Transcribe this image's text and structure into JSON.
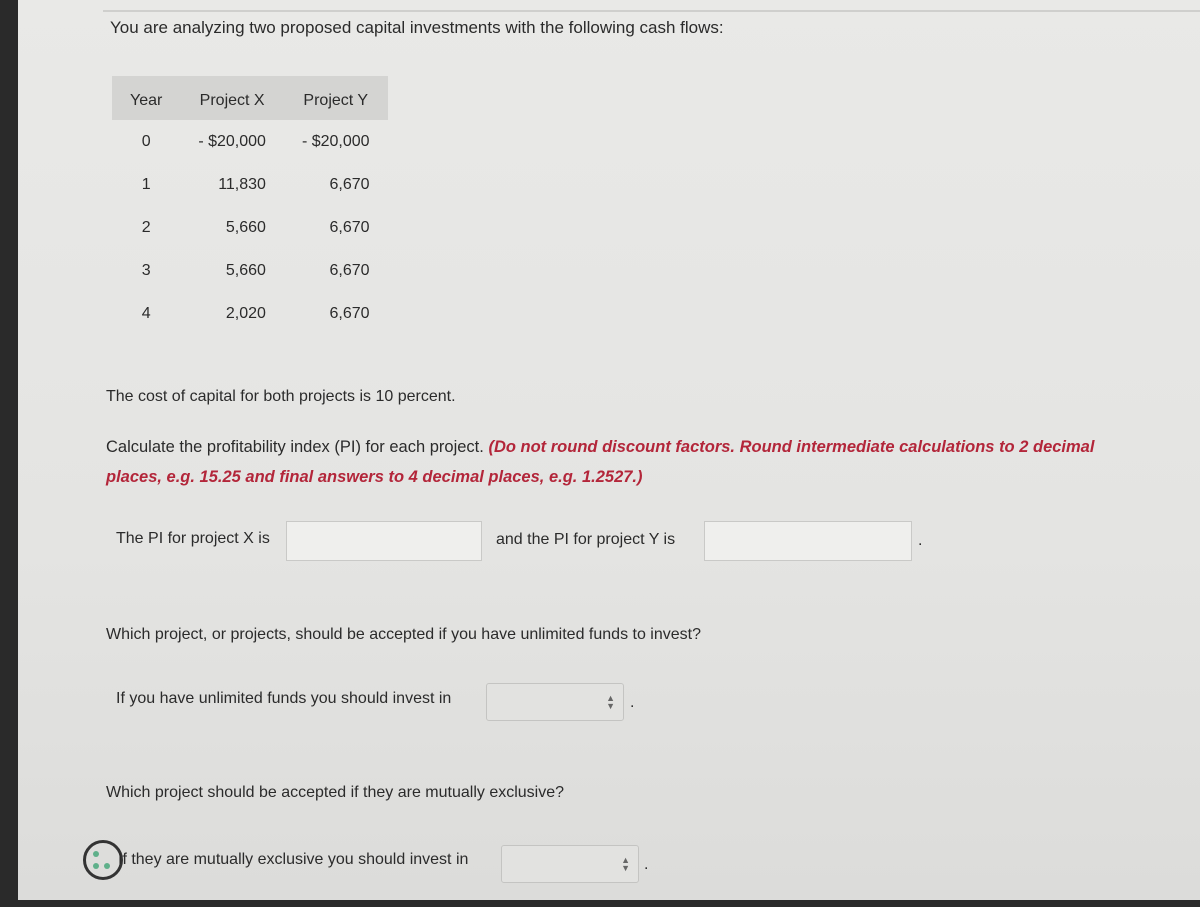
{
  "intro": "You are analyzing two proposed capital investments with the following cash flows:",
  "table": {
    "headers": [
      "Year",
      "Project X",
      "Project Y"
    ],
    "rows": [
      [
        "0",
        "- $20,000",
        "- $20,000"
      ],
      [
        "1",
        "11,830",
        "6,670"
      ],
      [
        "2",
        "5,660",
        "6,670"
      ],
      [
        "3",
        "5,660",
        "6,670"
      ],
      [
        "4",
        "2,020",
        "6,670"
      ]
    ]
  },
  "cost_of_capital": "The cost of capital for both projects is 10 percent.",
  "instruction": "Calculate the profitability index (PI) for each project.",
  "instruction_note": "(Do not round discount factors. Round intermediate calculations to 2 decimal places, e.g. 15.25 and final answers to 4 decimal places, e.g. 1.2527.)",
  "pi_x_label": "The PI for project X is",
  "pi_x_value": "",
  "pi_y_label": "and the PI for project Y is",
  "pi_y_value": "",
  "period": ".",
  "q_unlimited": "Which project, or projects, should be accepted if you have unlimited funds to invest?",
  "unlimited_label": "If you have unlimited funds you should invest in",
  "unlimited_value": "",
  "q_exclusive": "Which project should be accepted if they are mutually exclusive?",
  "exclusive_label": "If they are mutually exclusive you should invest in",
  "exclusive_value": ""
}
